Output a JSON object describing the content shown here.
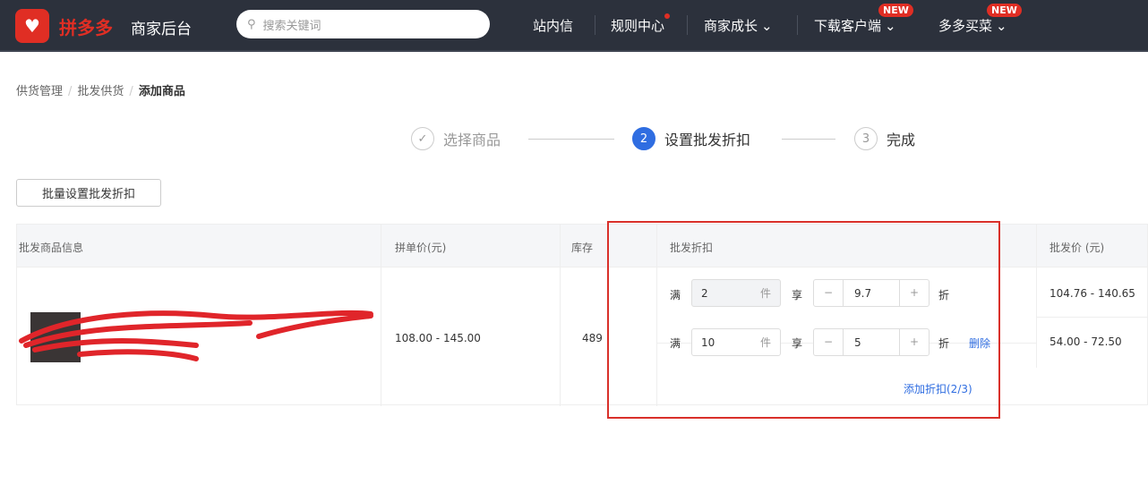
{
  "header": {
    "brand": "拼多多",
    "subtitle": "商家后台",
    "search_placeholder": "搜索关键词",
    "menu": [
      {
        "label": "站内信"
      },
      {
        "label": "规则中心"
      },
      {
        "label": "商家成长"
      },
      {
        "label": "下载客户端",
        "badge": "NEW"
      },
      {
        "label": "多多买菜",
        "badge": "NEW"
      }
    ]
  },
  "breadcrumb": [
    "供货管理",
    "批发供货",
    "添加商品"
  ],
  "steps": [
    {
      "num": "✓",
      "label": "选择商品"
    },
    {
      "num": "2",
      "label": "设置批发折扣"
    },
    {
      "num": "3",
      "label": "完成"
    }
  ],
  "batch_button": "批量设置批发折扣",
  "table": {
    "headers": [
      "批发商品信息",
      "拼单价(元)",
      "库存",
      "批发折扣",
      "批发价 (元)"
    ],
    "row": {
      "price": "108.00 - 145.00",
      "stock": "489",
      "tiers": [
        {
          "prefix": "满",
          "qty": "2",
          "unit": "件",
          "mid": "享",
          "discount": "9.7",
          "suffix": "折",
          "wholesale": "104.76 - 140.65"
        },
        {
          "prefix": "满",
          "qty": "10",
          "unit": "件",
          "mid": "享",
          "discount": "5",
          "suffix": "折",
          "delete": "删除",
          "wholesale": "54.00 - 72.50"
        }
      ],
      "add_discount": "添加折扣(2/3)"
    }
  }
}
